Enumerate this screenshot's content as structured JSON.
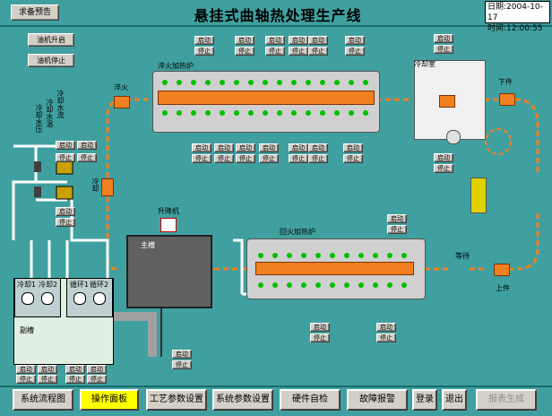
{
  "header": {
    "login_button": "求备预告",
    "title": "悬挂式曲轴热处理生产线",
    "date_label": "日期:",
    "date_value": "2004-10-17",
    "time_label": "时间:",
    "time_value": "12:00:55"
  },
  "left_panel": {
    "start_button": "油机升启",
    "stop_button": "油机停止",
    "vertical_labels": [
      "冷却水压",
      "冷却水温",
      "冷却水流"
    ],
    "quench_label": "淬火",
    "left_label": "冷却"
  },
  "furnace1": {
    "name": "淬火加热炉",
    "top_buttons": [
      [
        "启动",
        "停止"
      ],
      [
        "启动",
        "停止"
      ],
      [
        "启动",
        "停止"
      ],
      [
        "启动",
        "停止"
      ],
      [
        "启动",
        "停止"
      ],
      [
        "启动",
        "停止"
      ],
      [
        "启动",
        "停止"
      ]
    ],
    "bottom_buttons": [
      [
        "启动",
        "停止"
      ],
      [
        "启动",
        "停止"
      ],
      [
        "启动",
        "停止"
      ],
      [
        "启动",
        "停止"
      ],
      [
        "启动",
        "停止"
      ],
      [
        "启动",
        "停止"
      ],
      [
        "启动",
        "停止"
      ]
    ]
  },
  "cooler": {
    "name": "冷却室",
    "label_down": "下件",
    "start": "启动",
    "stop": "停止"
  },
  "furnace2": {
    "name": "回火加热炉",
    "up_label": "上件",
    "wait_label": "等待",
    "top_buttons": [
      [
        "启动",
        "停止"
      ],
      [
        "启动",
        "停止"
      ]
    ],
    "bottom_buttons": [
      [
        "启动",
        "停止"
      ],
      [
        "启动",
        "停止"
      ]
    ]
  },
  "tank": {
    "name": "主槽",
    "lift_label": "升降机",
    "start": "启动",
    "stop": "停止"
  },
  "subtank": {
    "name": "副槽",
    "pumps": [
      "冷却1",
      "冷却2",
      "循环1",
      "循环2"
    ],
    "buttons": [
      [
        "启动",
        "停止"
      ],
      [
        "启动",
        "停止"
      ],
      [
        "启动",
        "停止"
      ],
      [
        "启动",
        "停止"
      ]
    ]
  },
  "bottom_nav": {
    "items": [
      "系统流程图",
      "操作面板",
      "工艺参数设置",
      "系统参数设置",
      "硬件自检",
      "故障报警",
      "登录",
      "退出",
      "报表生成"
    ]
  },
  "colors": {
    "background": "#40a0a0",
    "furnace_part": "#f08020",
    "indicator_green": "#00c000",
    "conveyor": "#f08020"
  }
}
